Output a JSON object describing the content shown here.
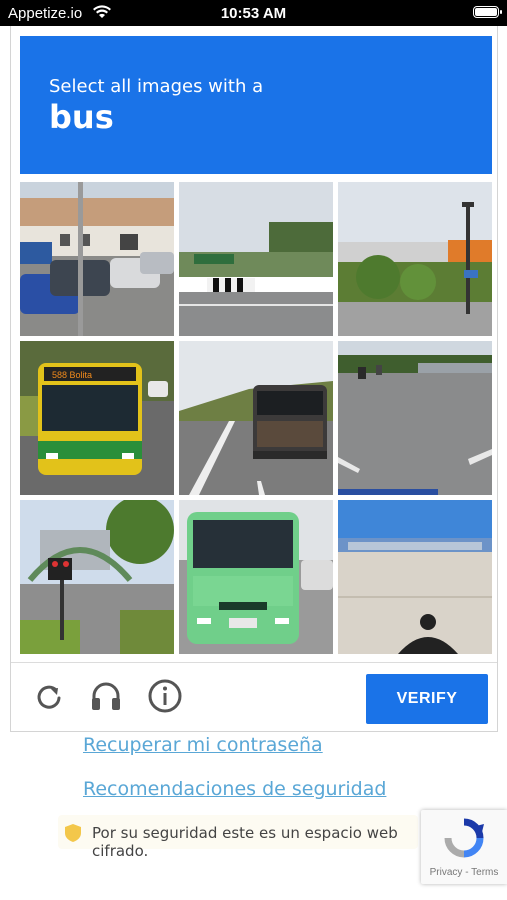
{
  "status_bar": {
    "carrier": "Appetize.io",
    "time": "10:53 AM"
  },
  "captcha": {
    "instruction": "Select all images with a",
    "target": "bus",
    "tiles": [
      {
        "label": "parking lot with cars"
      },
      {
        "label": "road with barrier"
      },
      {
        "label": "street with lamp post"
      },
      {
        "label": "yellow bus"
      },
      {
        "label": "bus on highway"
      },
      {
        "label": "empty road"
      },
      {
        "label": "traffic light"
      },
      {
        "label": "green bus"
      },
      {
        "label": "open lot"
      }
    ],
    "verify_label": "VERIFY",
    "icons": [
      "reload-icon",
      "audio-icon",
      "info-icon"
    ]
  },
  "links": {
    "recover": "Recuperar mi contraseña",
    "security": "Recomendaciones de seguridad"
  },
  "secure_notice": "Por su seguridad este es un espacio web cifrado.",
  "recaptcha": {
    "terms": "Privacy - Terms"
  },
  "colors": {
    "accent": "#1a73e8",
    "link": "#5aa7d6"
  }
}
